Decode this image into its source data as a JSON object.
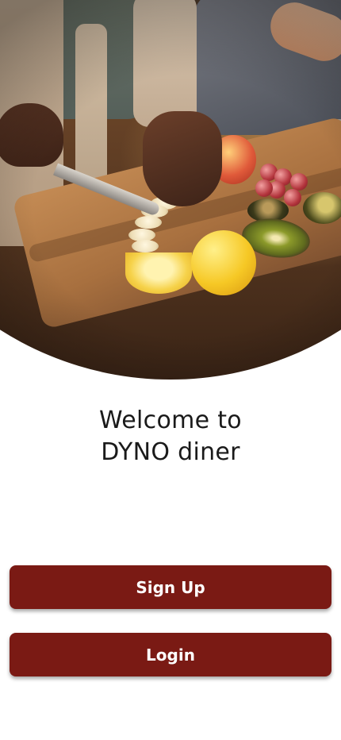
{
  "hero": {
    "image": "cooking-hero-image"
  },
  "welcome": {
    "line1": "Welcome to",
    "line2": "DYNO diner"
  },
  "buttons": {
    "signup_label": "Sign Up",
    "login_label": "Login"
  },
  "colors": {
    "primary": "#7a1a14",
    "background": "#ffffff",
    "text": "#1a1a1a"
  }
}
